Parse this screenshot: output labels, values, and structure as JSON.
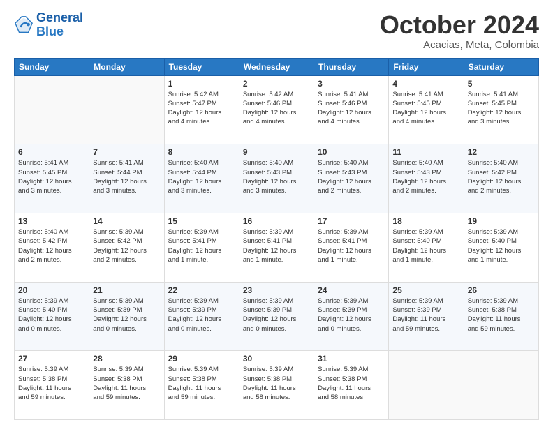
{
  "logo": {
    "line1": "General",
    "line2": "Blue"
  },
  "title": "October 2024",
  "location": "Acacias, Meta, Colombia",
  "weekdays": [
    "Sunday",
    "Monday",
    "Tuesday",
    "Wednesday",
    "Thursday",
    "Friday",
    "Saturday"
  ],
  "weeks": [
    [
      {
        "day": "",
        "info": ""
      },
      {
        "day": "",
        "info": ""
      },
      {
        "day": "1",
        "info": "Sunrise: 5:42 AM\nSunset: 5:47 PM\nDaylight: 12 hours\nand 4 minutes."
      },
      {
        "day": "2",
        "info": "Sunrise: 5:42 AM\nSunset: 5:46 PM\nDaylight: 12 hours\nand 4 minutes."
      },
      {
        "day": "3",
        "info": "Sunrise: 5:41 AM\nSunset: 5:46 PM\nDaylight: 12 hours\nand 4 minutes."
      },
      {
        "day": "4",
        "info": "Sunrise: 5:41 AM\nSunset: 5:45 PM\nDaylight: 12 hours\nand 4 minutes."
      },
      {
        "day": "5",
        "info": "Sunrise: 5:41 AM\nSunset: 5:45 PM\nDaylight: 12 hours\nand 3 minutes."
      }
    ],
    [
      {
        "day": "6",
        "info": "Sunrise: 5:41 AM\nSunset: 5:45 PM\nDaylight: 12 hours\nand 3 minutes."
      },
      {
        "day": "7",
        "info": "Sunrise: 5:41 AM\nSunset: 5:44 PM\nDaylight: 12 hours\nand 3 minutes."
      },
      {
        "day": "8",
        "info": "Sunrise: 5:40 AM\nSunset: 5:44 PM\nDaylight: 12 hours\nand 3 minutes."
      },
      {
        "day": "9",
        "info": "Sunrise: 5:40 AM\nSunset: 5:43 PM\nDaylight: 12 hours\nand 3 minutes."
      },
      {
        "day": "10",
        "info": "Sunrise: 5:40 AM\nSunset: 5:43 PM\nDaylight: 12 hours\nand 2 minutes."
      },
      {
        "day": "11",
        "info": "Sunrise: 5:40 AM\nSunset: 5:43 PM\nDaylight: 12 hours\nand 2 minutes."
      },
      {
        "day": "12",
        "info": "Sunrise: 5:40 AM\nSunset: 5:42 PM\nDaylight: 12 hours\nand 2 minutes."
      }
    ],
    [
      {
        "day": "13",
        "info": "Sunrise: 5:40 AM\nSunset: 5:42 PM\nDaylight: 12 hours\nand 2 minutes."
      },
      {
        "day": "14",
        "info": "Sunrise: 5:39 AM\nSunset: 5:42 PM\nDaylight: 12 hours\nand 2 minutes."
      },
      {
        "day": "15",
        "info": "Sunrise: 5:39 AM\nSunset: 5:41 PM\nDaylight: 12 hours\nand 1 minute."
      },
      {
        "day": "16",
        "info": "Sunrise: 5:39 AM\nSunset: 5:41 PM\nDaylight: 12 hours\nand 1 minute."
      },
      {
        "day": "17",
        "info": "Sunrise: 5:39 AM\nSunset: 5:41 PM\nDaylight: 12 hours\nand 1 minute."
      },
      {
        "day": "18",
        "info": "Sunrise: 5:39 AM\nSunset: 5:40 PM\nDaylight: 12 hours\nand 1 minute."
      },
      {
        "day": "19",
        "info": "Sunrise: 5:39 AM\nSunset: 5:40 PM\nDaylight: 12 hours\nand 1 minute."
      }
    ],
    [
      {
        "day": "20",
        "info": "Sunrise: 5:39 AM\nSunset: 5:40 PM\nDaylight: 12 hours\nand 0 minutes."
      },
      {
        "day": "21",
        "info": "Sunrise: 5:39 AM\nSunset: 5:39 PM\nDaylight: 12 hours\nand 0 minutes."
      },
      {
        "day": "22",
        "info": "Sunrise: 5:39 AM\nSunset: 5:39 PM\nDaylight: 12 hours\nand 0 minutes."
      },
      {
        "day": "23",
        "info": "Sunrise: 5:39 AM\nSunset: 5:39 PM\nDaylight: 12 hours\nand 0 minutes."
      },
      {
        "day": "24",
        "info": "Sunrise: 5:39 AM\nSunset: 5:39 PM\nDaylight: 12 hours\nand 0 minutes."
      },
      {
        "day": "25",
        "info": "Sunrise: 5:39 AM\nSunset: 5:39 PM\nDaylight: 11 hours\nand 59 minutes."
      },
      {
        "day": "26",
        "info": "Sunrise: 5:39 AM\nSunset: 5:38 PM\nDaylight: 11 hours\nand 59 minutes."
      }
    ],
    [
      {
        "day": "27",
        "info": "Sunrise: 5:39 AM\nSunset: 5:38 PM\nDaylight: 11 hours\nand 59 minutes."
      },
      {
        "day": "28",
        "info": "Sunrise: 5:39 AM\nSunset: 5:38 PM\nDaylight: 11 hours\nand 59 minutes."
      },
      {
        "day": "29",
        "info": "Sunrise: 5:39 AM\nSunset: 5:38 PM\nDaylight: 11 hours\nand 59 minutes."
      },
      {
        "day": "30",
        "info": "Sunrise: 5:39 AM\nSunset: 5:38 PM\nDaylight: 11 hours\nand 58 minutes."
      },
      {
        "day": "31",
        "info": "Sunrise: 5:39 AM\nSunset: 5:38 PM\nDaylight: 11 hours\nand 58 minutes."
      },
      {
        "day": "",
        "info": ""
      },
      {
        "day": "",
        "info": ""
      }
    ]
  ]
}
